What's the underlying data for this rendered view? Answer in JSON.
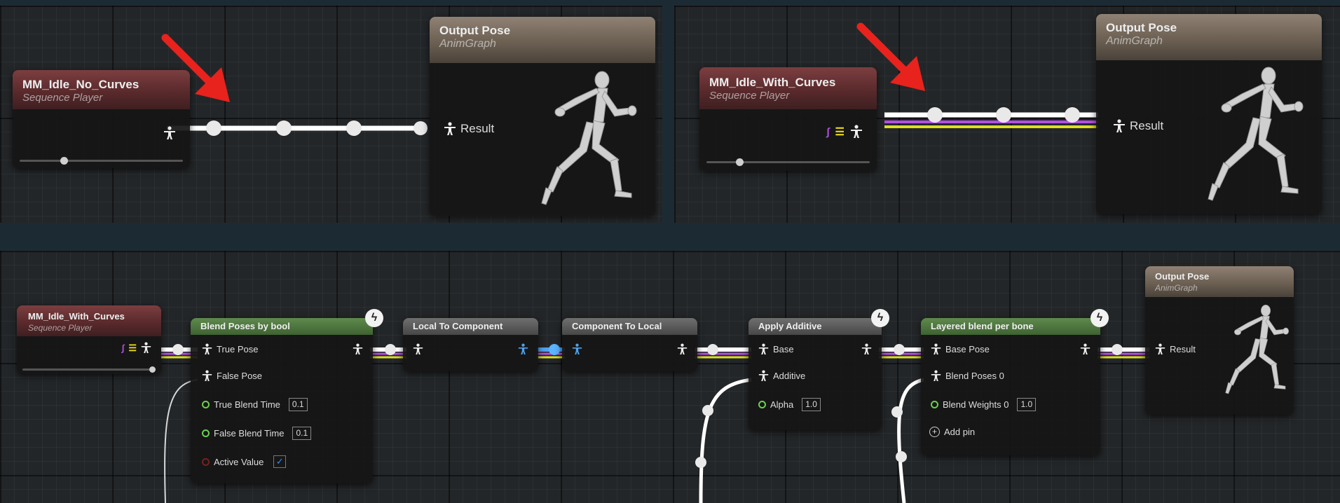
{
  "top_left": {
    "source": {
      "title": "MM_Idle_No_Curves",
      "subtitle": "Sequence Player"
    },
    "output": {
      "title": "Output Pose",
      "subtitle": "AnimGraph",
      "result_label": "Result"
    }
  },
  "top_right": {
    "source": {
      "title": "MM_Idle_With_Curves",
      "subtitle": "Sequence Player"
    },
    "output": {
      "title": "Output Pose",
      "subtitle": "AnimGraph",
      "result_label": "Result"
    }
  },
  "bottom": {
    "source": {
      "title": "MM_Idle_With_Curves",
      "subtitle": "Sequence Player"
    },
    "blend_bool": {
      "title": "Blend Poses by bool",
      "pins": {
        "true_pose": "True Pose",
        "false_pose": "False Pose",
        "true_blend_time": "True Blend Time",
        "false_blend_time": "False Blend Time",
        "active_value": "Active Value"
      },
      "true_blend_time_value": "0.1",
      "false_blend_time_value": "0.1",
      "active_value_checked": "✓"
    },
    "local_to_component": {
      "title": "Local To Component"
    },
    "component_to_local": {
      "title": "Component To Local"
    },
    "apply_additive": {
      "title": "Apply Additive",
      "pins": {
        "base": "Base",
        "additive": "Additive",
        "alpha": "Alpha"
      },
      "alpha_value": "1.0"
    },
    "layered_blend": {
      "title": "Layered blend per bone",
      "pins": {
        "base_pose": "Base Pose",
        "blend_poses_0": "Blend Poses 0",
        "blend_weights_0": "Blend Weights 0",
        "add_pin": "Add pin"
      },
      "blend_weights_value": "1.0"
    },
    "output": {
      "title": "Output Pose",
      "subtitle": "AnimGraph",
      "result_label": "Result"
    }
  },
  "colors": {
    "pose_wire": "#ffffff",
    "curve_wire": "#b44fe2",
    "attribute_wire": "#f3e11a",
    "component_wire": "#4ea3ee",
    "annotation_arrow": "#e8221c"
  },
  "icons": [
    "pose-pin-icon",
    "curve-icon",
    "attribute-list-icon",
    "fast-path-bolt-icon",
    "mannequin-icon",
    "annotation-arrow"
  ]
}
